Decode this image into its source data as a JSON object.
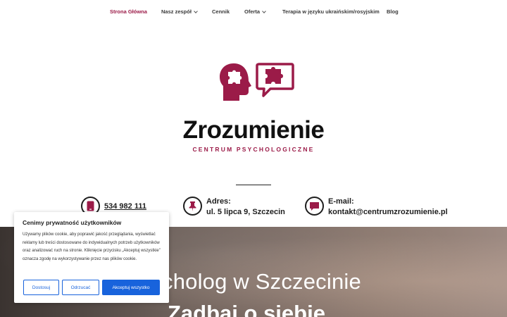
{
  "nav": {
    "items": [
      {
        "label": "Strona Główna",
        "active": true,
        "has_dropdown": false
      },
      {
        "label": "Nasz zespół",
        "active": false,
        "has_dropdown": true
      },
      {
        "label": "Cennik",
        "active": false,
        "has_dropdown": false
      },
      {
        "label": "Oferta",
        "active": false,
        "has_dropdown": true
      },
      {
        "label": "Terapia w języku ukraińskim/rosyjskim",
        "active": false,
        "has_dropdown": false
      },
      {
        "label": "Blog",
        "active": false,
        "has_dropdown": false
      }
    ]
  },
  "brand": {
    "name": "Zrozumienie",
    "tagline": "CENTRUM PSYCHOLOGICZNE",
    "accent_color": "#9b1b48",
    "logo_icons": [
      "head-puzzle-icon",
      "speech-bubble-puzzle-icon"
    ]
  },
  "contacts": {
    "phone": {
      "value": "534 982 111",
      "icon": "phone-icon"
    },
    "address": {
      "label": "Adres:",
      "value": "ul. 5 lipca 9, Szczecin",
      "icon": "map-pin-icon"
    },
    "email": {
      "label": "E-mail:",
      "value": "kontakt@centrumzrozumienie.pl",
      "icon": "chat-bubble-icon"
    }
  },
  "hero": {
    "title_partial": "cholog w Szczecinie",
    "subtitle_partial": "Zadbaj o siebie"
  },
  "cookie": {
    "title": "Cenimy prywatność użytkowników",
    "text": "Używamy plików cookie, aby poprawić jakość przeglądania, wyświetlać reklamy lub treści dostosowane do indywidualnych potrzeb użytkowników oraz analizować ruch na stronie. Kliknięcie przycisku „Akceptuj wszystkie” oznacza zgodę na wykorzystywanie przez nas plików cookie.",
    "buttons": {
      "customize": "Dostosuj",
      "reject": "Odrzucać",
      "accept": "Akceptuj wszystko"
    },
    "button_color": "#1863dc"
  }
}
